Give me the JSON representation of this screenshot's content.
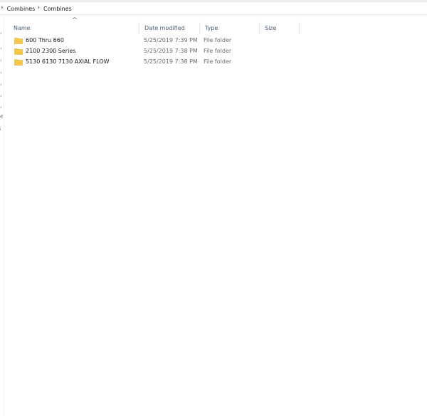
{
  "breadcrumb": {
    "items": [
      "Combines",
      "Combines"
    ]
  },
  "nav_pane": {
    "glyphs": [
      "›",
      "›",
      "›",
      "›",
      "›",
      "›",
      "›",
      "M",
      "S",
      "J"
    ]
  },
  "columns": {
    "name": "Name",
    "date_modified": "Date modified",
    "type": "Type",
    "size": "Size"
  },
  "files": [
    {
      "name": "600 Thru 660",
      "date_modified": "5/25/2019 7:39 PM",
      "type": "File folder",
      "size": ""
    },
    {
      "name": "2100 2300 Series",
      "date_modified": "5/25/2019 7:38 PM",
      "type": "File folder",
      "size": ""
    },
    {
      "name": "5130 6130 7130 AXIAL FLOW",
      "date_modified": "5/25/2019 7:38 PM",
      "type": "File folder",
      "size": ""
    }
  ],
  "colors": {
    "folder": "#f5c74a",
    "header_text": "#4c607a",
    "secondary_text": "#6d6d6d"
  },
  "icons": {
    "folder": "folder-icon",
    "sort": "sort-ascending-icon",
    "breadcrumb_separator": "chevron-right-icon"
  }
}
